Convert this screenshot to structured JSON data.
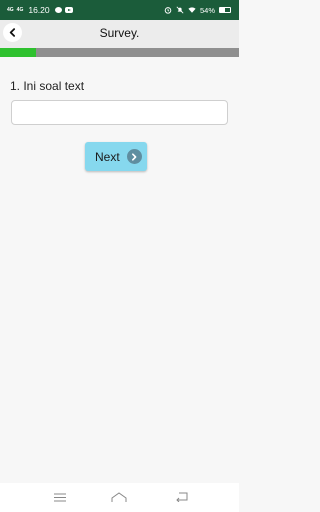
{
  "status_bar": {
    "net1": "4G",
    "net2": "4G",
    "time": "16.20",
    "battery": "54%",
    "battery_level": 0.54,
    "background": "#1b5c3a",
    "icons": [
      "chat-icon",
      "youtube-icon",
      "alarm-icon",
      "mute-icon",
      "wifi-icon",
      "battery-icon"
    ]
  },
  "app_bar": {
    "title": "Survey.",
    "back_icon": "chevron-left-icon"
  },
  "progress": {
    "value": 0.15,
    "fill_color": "#2fc12f",
    "track_color": "#8f8f8f"
  },
  "question": {
    "text": "1. Ini soal text",
    "answer_value": "",
    "answer_placeholder": ""
  },
  "next_button": {
    "label": "Next",
    "icon": "chevron-right-icon",
    "color": "#86d8ee"
  },
  "nav_bar": {
    "icons": [
      "menu-icon",
      "home-icon",
      "back-icon"
    ]
  }
}
